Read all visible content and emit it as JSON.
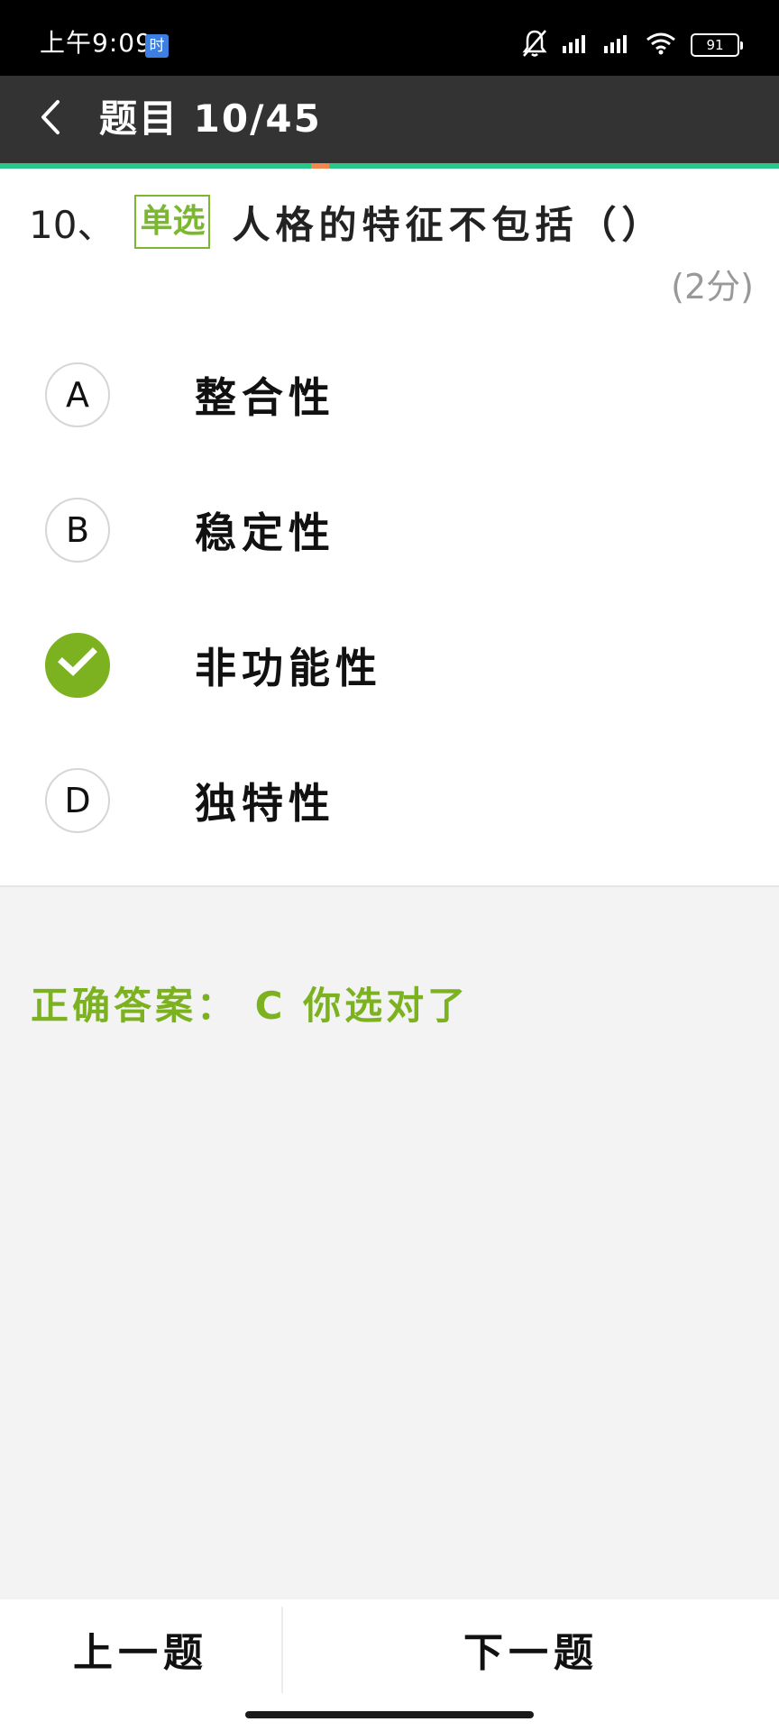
{
  "status_bar": {
    "time": "上午9:09",
    "badge": "时",
    "battery": "91",
    "icons": [
      "bell-muted-icon",
      "signal-icon",
      "signal-icon",
      "wifi-icon",
      "battery-icon"
    ]
  },
  "header": {
    "title": "题目 10/45",
    "back_icon": "chevron-left-icon"
  },
  "progress": {
    "current": 10,
    "total": 45
  },
  "question": {
    "number": "10、",
    "type": "单选",
    "text": "人格的特征不包括（）",
    "score": "(2分)"
  },
  "options": [
    {
      "letter": "A",
      "label": "整合性",
      "selected": false
    },
    {
      "letter": "B",
      "label": "稳定性",
      "selected": false
    },
    {
      "letter": "C",
      "label": "非功能性",
      "selected": true
    },
    {
      "letter": "D",
      "label": "独特性",
      "selected": false
    }
  ],
  "answer": {
    "text": "正确答案： C  你选对了"
  },
  "footer": {
    "prev_label": "上一题",
    "next_label": "下一题"
  },
  "colors": {
    "accent_green": "#7cb21f",
    "progress_green": "#27c889",
    "progress_marker": "#f2884c",
    "header_bg": "#333333"
  }
}
